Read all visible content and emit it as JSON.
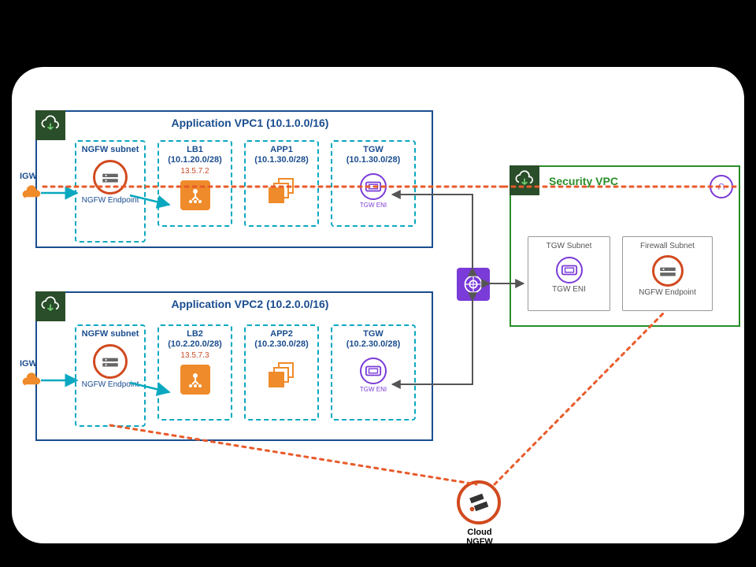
{
  "vpc1": {
    "title": "Application VPC1 (10.1.0.0/16)",
    "igw": "IGW",
    "ngfw_subnet": "NGFW subnet",
    "ngfw_endpoint": "NGFW Endpoint",
    "lb": {
      "name": "LB1",
      "cidr": "(10.1.20.0/28)",
      "eip": "13.5.7.2"
    },
    "app": {
      "name": "APP1",
      "cidr": "(10.1.30.0/28)"
    },
    "tgw": {
      "name": "TGW",
      "cidr": "(10.1.30.0/28)",
      "eni": "TGW ENI"
    }
  },
  "vpc2": {
    "title": "Application VPC2 (10.2.0.0/16)",
    "igw": "IGW",
    "ngfw_subnet": "NGFW subnet",
    "ngfw_endpoint": "NGFW Endpoint",
    "lb": {
      "name": "LB2",
      "cidr": "(10.2.20.0/28)",
      "eip": "13.5.7.3"
    },
    "app": {
      "name": "APP2",
      "cidr": "(10.2.30.0/28)"
    },
    "tgw": {
      "name": "TGW",
      "cidr": "(10.2.30.0/28)",
      "eni": "TGW ENI"
    }
  },
  "secvpc": {
    "title": "Security VPC",
    "tgw_subnet": "TGW Subnet",
    "tgw_eni": "TGW ENI",
    "fw_subnet": "Firewall Subnet",
    "ngfw_endpoint": "NGFW Endpoint"
  },
  "cloud_ngfw": "Cloud NGFW"
}
